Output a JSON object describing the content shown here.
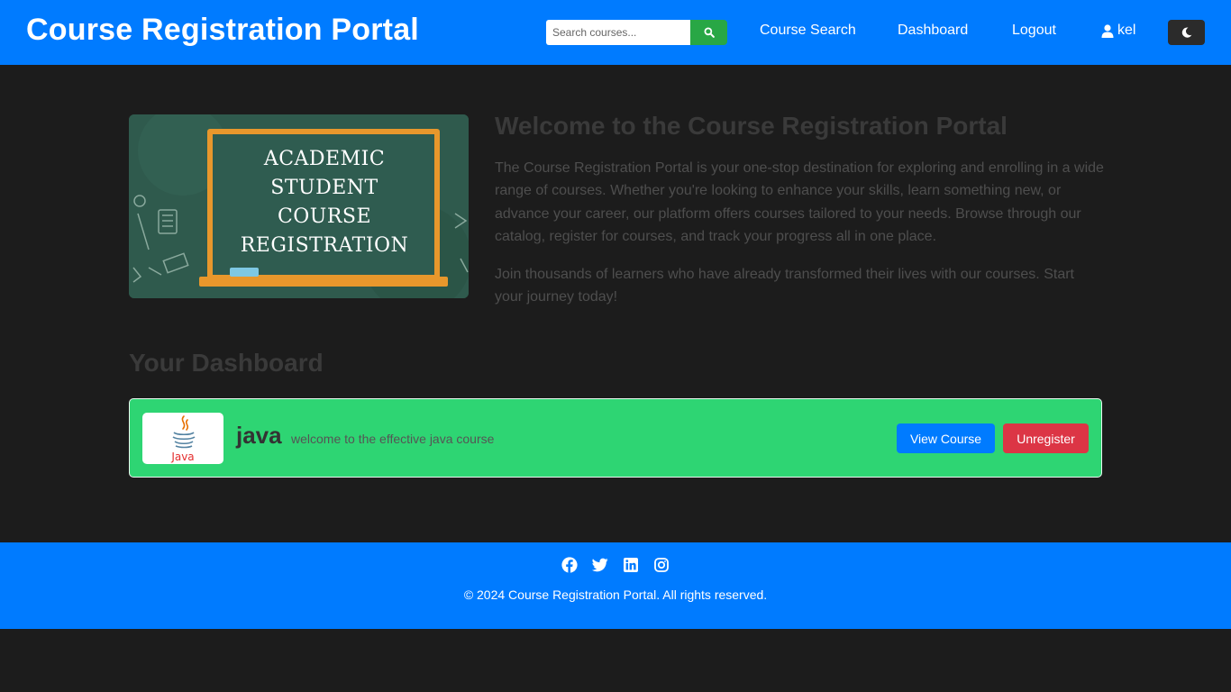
{
  "header": {
    "brand": "Course Registration Portal",
    "search_placeholder": "Search courses...",
    "nav": {
      "course_search": "Course Search",
      "dashboard": "Dashboard",
      "logout": "Logout"
    },
    "user": "kel",
    "icons": {
      "search": "search-icon",
      "user": "user-icon",
      "theme": "moon-icon"
    }
  },
  "hero": {
    "image_text": [
      "ACADEMIC",
      "STUDENT",
      "COURSE",
      "REGISTRATION"
    ],
    "title": "Welcome to the Course Registration Portal",
    "paragraph1": "The Course Registration Portal is your one-stop destination for exploring and enrolling in a wide range of courses. Whether you're looking to enhance your skills, learn something new, or advance your career, our platform offers courses tailored to your needs. Browse through our catalog, register for courses, and track your progress all in one place.",
    "paragraph2": "Join thousands of learners who have already transformed their lives with our courses. Start your journey today!"
  },
  "dashboard": {
    "title": "Your Dashboard",
    "courses": [
      {
        "name": "java",
        "description": "welcome to the effective java course",
        "logo_text": "Java",
        "view_label": "View Course",
        "unregister_label": "Unregister"
      }
    ]
  },
  "footer": {
    "copyright": "© 2024 Course Registration Portal. All rights reserved.",
    "socials": [
      "facebook-icon",
      "twitter-icon",
      "linkedin-icon",
      "instagram-icon"
    ]
  },
  "colors": {
    "primary": "#007bff",
    "success": "#28a745",
    "card": "#2ed573",
    "danger": "#dc3545",
    "background": "#1c1c1c"
  }
}
